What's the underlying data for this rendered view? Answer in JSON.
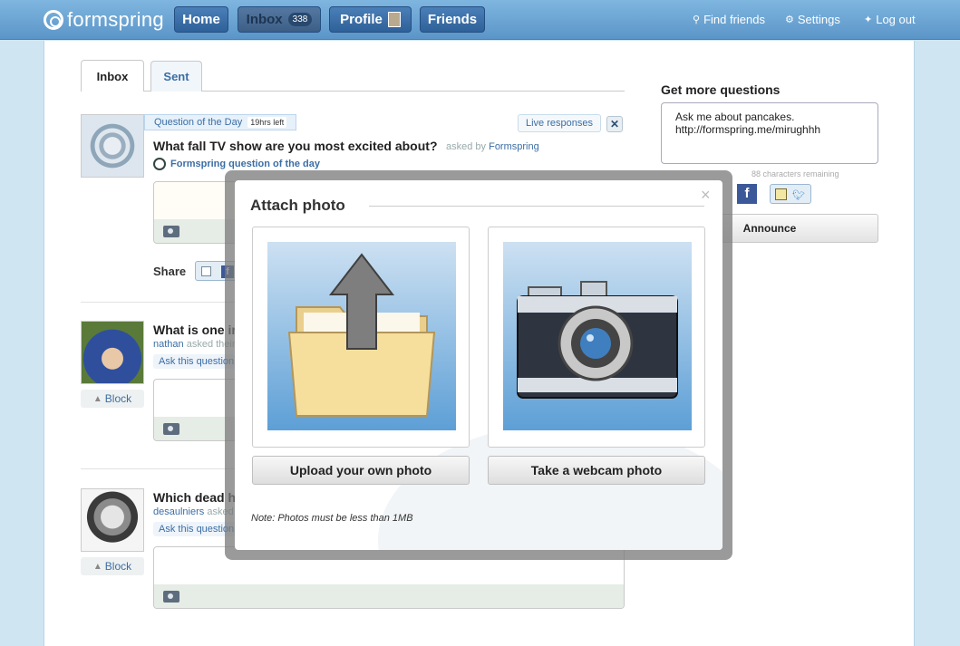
{
  "header": {
    "logo_text": "formspring",
    "nav": {
      "home": "Home",
      "inbox": "Inbox",
      "inbox_count": "338",
      "profile": "Profile",
      "friends": "Friends"
    },
    "links": {
      "find_friends": "Find friends",
      "settings": "Settings",
      "logout": "Log out"
    }
  },
  "tabs": {
    "inbox": "Inbox",
    "sent": "Sent"
  },
  "qotd": {
    "banner": "Question of the Day",
    "time_left": "19hrs left",
    "live_responses": "Live responses",
    "question": "What fall TV show are you most excited about?",
    "asked_by_prefix": "asked by",
    "asker": "Formspring",
    "link": "Formspring question of the day",
    "share_label": "Share",
    "fb_letter": "f"
  },
  "questions": [
    {
      "question": "What is one ir",
      "asker": "nathan",
      "asked_suffix": "asked their",
      "ask_this": "Ask this question",
      "block": "Block"
    },
    {
      "question": "Which dead h",
      "asker": "desaulniers",
      "asked_suffix": "asked",
      "ask_this": "Ask this question",
      "block": "Block"
    }
  ],
  "sidebar": {
    "title": "Get more questions",
    "box_line1": "Ask me about pancakes.",
    "box_line2": "http://formspring.me/mirughhh",
    "chars_remaining": "88 characters remaining",
    "fb_letter": "f",
    "announce": "Announce"
  },
  "modal": {
    "title": "Attach photo",
    "upload_button": "Upload your own photo",
    "webcam_button": "Take a webcam photo",
    "note": "Note: Photos must be less than 1MB",
    "close": "×"
  }
}
